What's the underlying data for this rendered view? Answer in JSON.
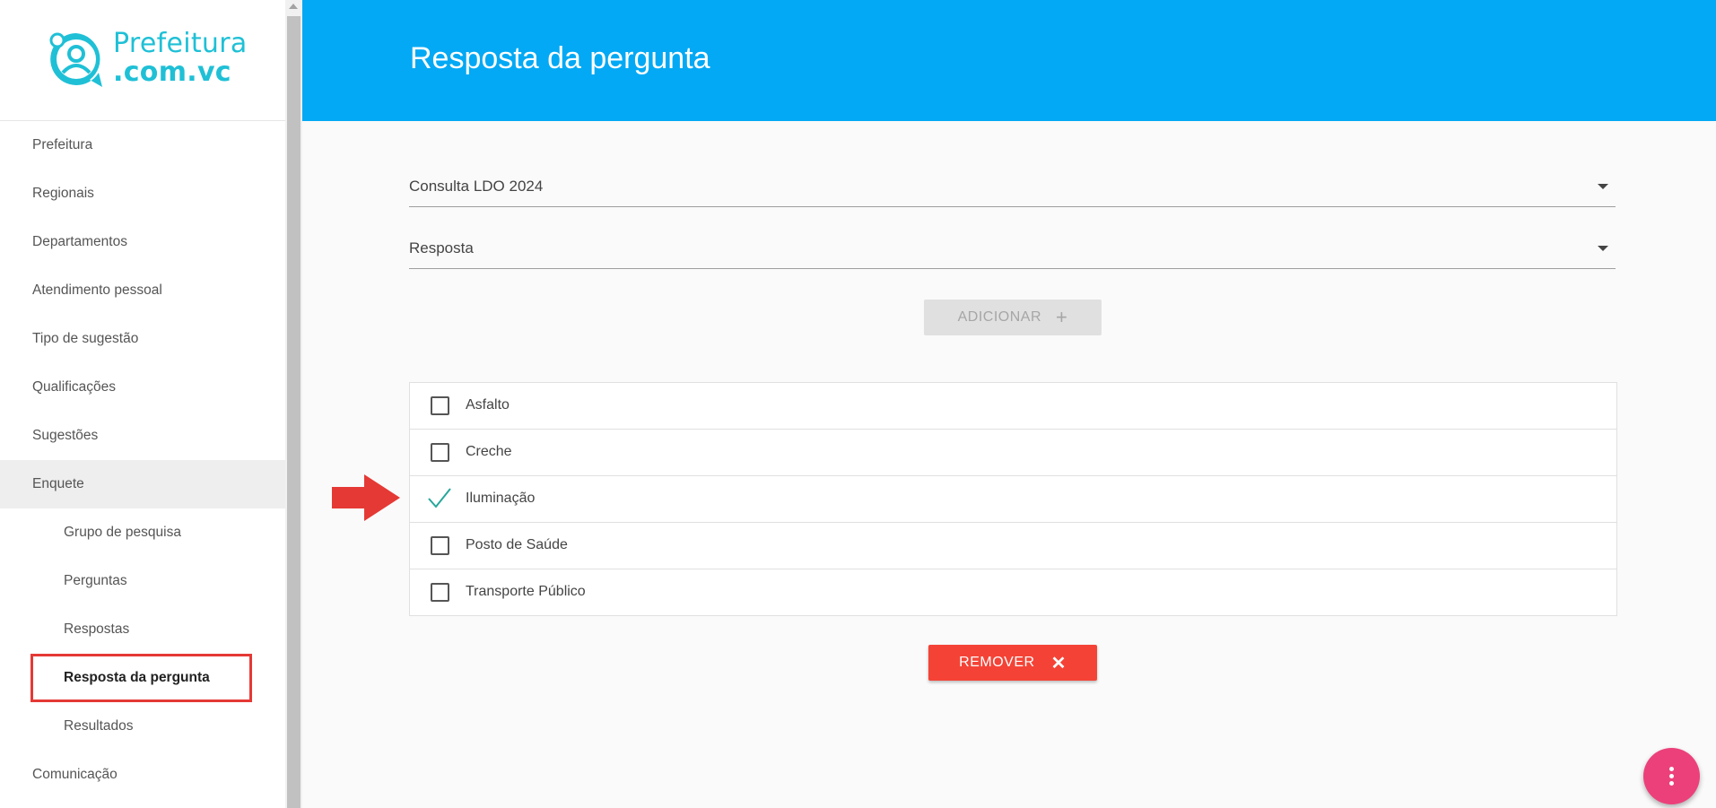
{
  "brand": {
    "line1": "Prefeitura",
    "line2": ".com.vc"
  },
  "sidebar": {
    "items": [
      {
        "label": "Prefeitura"
      },
      {
        "label": "Regionais"
      },
      {
        "label": "Departamentos"
      },
      {
        "label": "Atendimento pessoal"
      },
      {
        "label": "Tipo de sugestão"
      },
      {
        "label": "Qualificações"
      },
      {
        "label": "Sugestões"
      },
      {
        "label": "Enquete"
      }
    ],
    "subitems": [
      {
        "label": "Grupo de pesquisa"
      },
      {
        "label": "Perguntas"
      },
      {
        "label": "Respostas"
      },
      {
        "label": "Resposta da pergunta"
      },
      {
        "label": "Resultados"
      }
    ],
    "after": {
      "label": "Comunicação"
    }
  },
  "header": {
    "title": "Resposta da pergunta"
  },
  "form": {
    "question_select": {
      "value": "Consulta LDO 2024"
    },
    "answer_select": {
      "value": "Resposta"
    },
    "add_button": {
      "label": "ADICIONAR",
      "icon": "plus-icon"
    }
  },
  "answers": [
    {
      "label": "Asfalto",
      "checked": false
    },
    {
      "label": "Creche",
      "checked": false
    },
    {
      "label": "Iluminação",
      "checked": true
    },
    {
      "label": "Posto de Saúde",
      "checked": false
    },
    {
      "label": "Transporte Público",
      "checked": false
    }
  ],
  "remove_button": {
    "label": "REMOVER",
    "icon": "close-icon"
  },
  "colors": {
    "header": "#03a9f4",
    "brand": "#1fc0d6",
    "remove": "#f44336",
    "fab": "#ec407a",
    "annotation": "#e53935",
    "check": "#26a69a"
  }
}
